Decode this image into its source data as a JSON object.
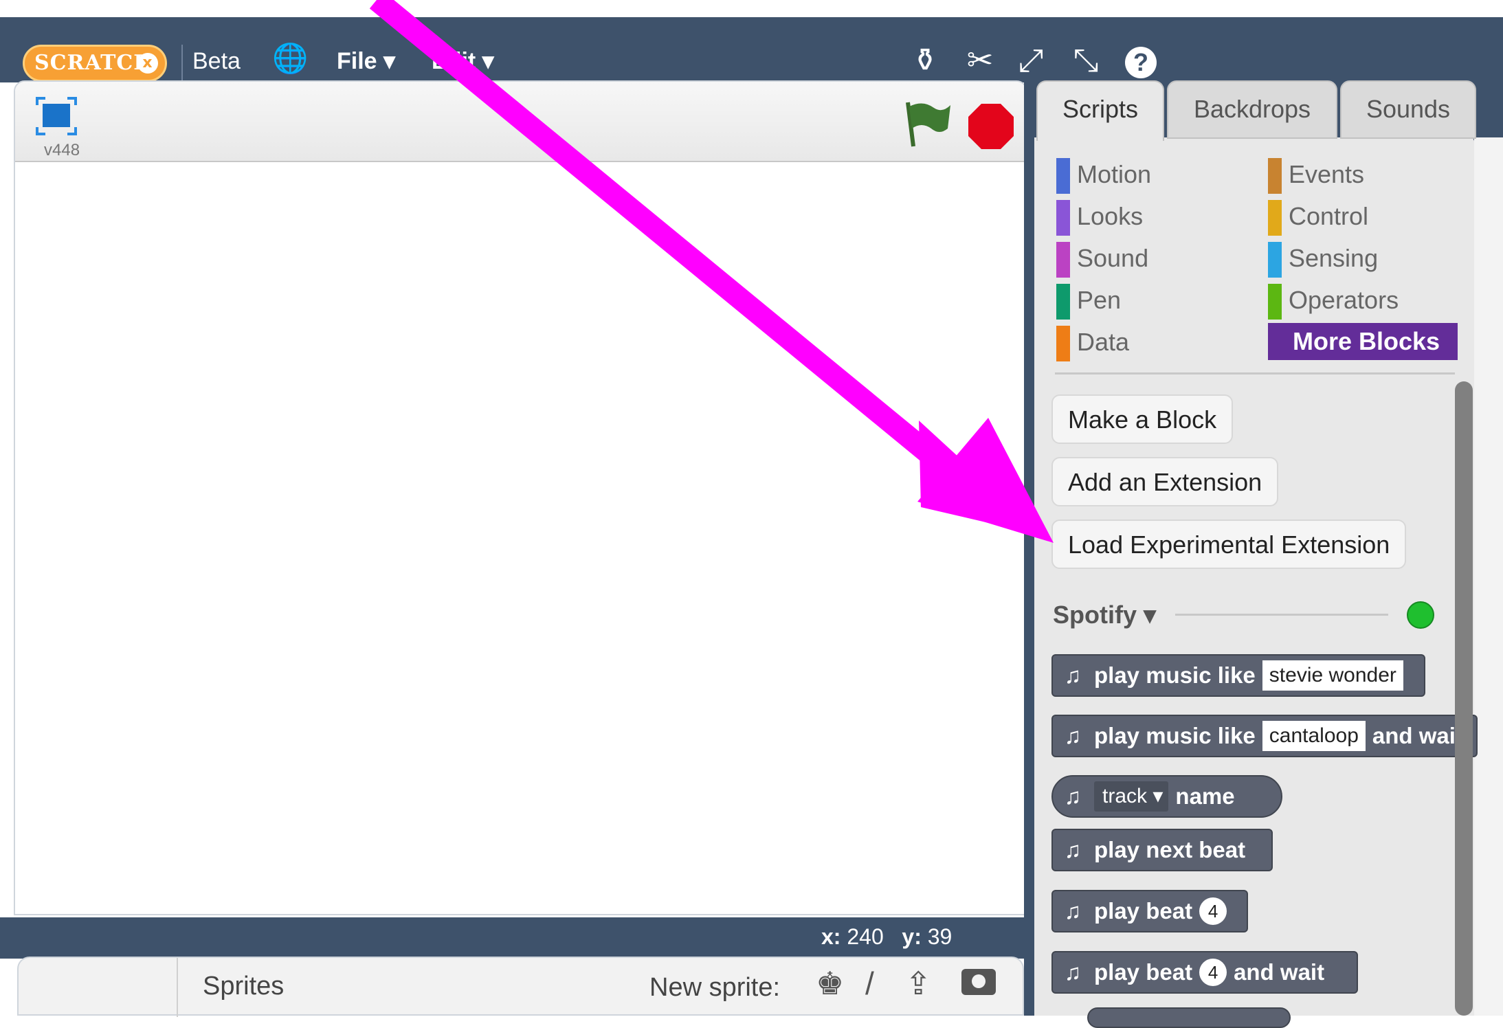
{
  "menubar": {
    "logo": "SCRATCH",
    "logo_x": "x",
    "beta": "Beta",
    "file": "File ▾",
    "edit": "Edit ▾",
    "tools": [
      "duplicate-icon",
      "cut-icon",
      "grow-icon",
      "shrink-icon",
      "help-icon"
    ]
  },
  "stage": {
    "version": "v448",
    "x_label": "x:",
    "x_value": "240",
    "y_label": "y:",
    "y_value": "39"
  },
  "sprites": {
    "title": "Sprites",
    "new_sprite": "New sprite:"
  },
  "tabs": [
    "Scripts",
    "Backdrops",
    "Sounds"
  ],
  "categories": {
    "left": [
      "Motion",
      "Looks",
      "Sound",
      "Pen",
      "Data"
    ],
    "right": [
      "Events",
      "Control",
      "Sensing",
      "Operators",
      "More Blocks"
    ]
  },
  "colors": {
    "motion": "#4a6cd4",
    "looks": "#8a55d7",
    "sound": "#bb42c3",
    "pen": "#0e9a6c",
    "data": "#ee7d16",
    "events": "#c88330",
    "control": "#e1a91a",
    "sensing": "#2ca5e2",
    "operators": "#5cb712",
    "more": "#632d99",
    "arrow": "#ff00ff"
  },
  "buttons": {
    "make_block": "Make a Block",
    "add_extension": "Add an Extension",
    "load_experimental": "Load Experimental Extension"
  },
  "extension": {
    "name": "Spotify ▾"
  },
  "blocks": {
    "b1": {
      "label": "play music like",
      "arg": "stevie wonder"
    },
    "b2": {
      "label": "play music like",
      "arg": "cantaloop",
      "tail": "and wait"
    },
    "b3": {
      "arg": "track",
      "tail": "name"
    },
    "b4": {
      "label": "play next beat"
    },
    "b5": {
      "label": "play beat",
      "arg": "4"
    },
    "b6": {
      "label": "play beat",
      "arg": "4",
      "tail": "and wait"
    }
  }
}
